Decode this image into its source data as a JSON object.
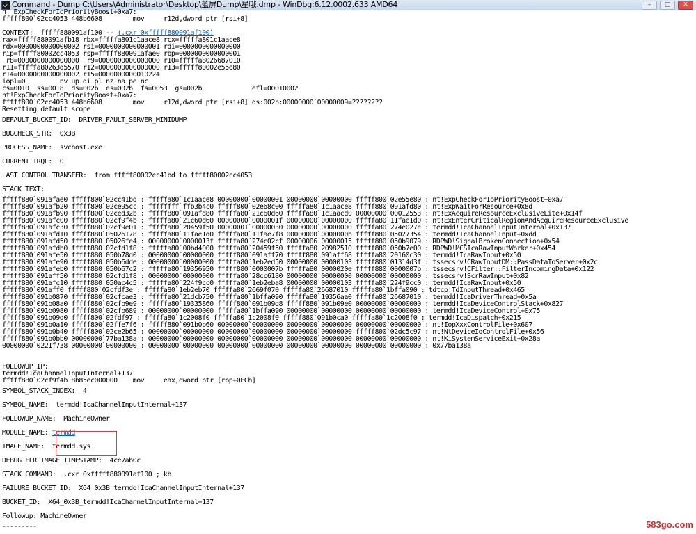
{
  "window": {
    "title": "Command - Dump C:\\Users\\Administrator\\Desktop\\蓝屏Dump\\星哦.dmp - WinDbg:6.12.0002.633 AMD64",
    "buttons": {
      "minimize": "–",
      "maximize": "□",
      "close": "✕"
    }
  },
  "lines": [
    {
      "t": "n! ExpCheckForIoPriorityBoost+0xa7:",
      "k": "line"
    },
    {
      "t": "fffff800`02cc4053 448b6608        mov     r12d,dword ptr [rsi+8]",
      "k": "line"
    },
    {
      "t": "",
      "k": "blank"
    },
    {
      "t": "CONTEXT:  fffff880091af100 -- ",
      "k": "ctx",
      "link": "(.cxr 0xfffff880091af100)"
    },
    {
      "t": "rax=fffff880091afb18 rbx=fffffa801c1aace8 rcx=fffffa801c1aace8",
      "k": "line"
    },
    {
      "t": "rdx=0000000000000002 rsi=0000000000000001 rdi=0000000000000000",
      "k": "line"
    },
    {
      "t": "rip=fffff80002cc4053 rsp=fffff880091afae0 rbp=0000000000000001",
      "k": "line"
    },
    {
      "t": " r8=0000000000000000  r9=0000000000000000 r10=fffffa8026687010",
      "k": "line"
    },
    {
      "t": "r11=fffffa80263d5570 r12=0000000000000000 r13=fffff80002e55e80",
      "k": "line"
    },
    {
      "t": "r14=0000000000000002 r15=0000000000010224",
      "k": "line"
    },
    {
      "t": "iopl=0         nv up di pl nz na pe nc",
      "k": "line"
    },
    {
      "t": "cs=0010  ss=0018  ds=002b  es=002b  fs=0053  gs=002b             efl=00010002",
      "k": "line"
    },
    {
      "t": "nt!ExpCheckForIoPriorityBoost+0xa7:",
      "k": "line"
    },
    {
      "t": "fffff800`02cc4053 448b6608        mov     r12d,dword ptr [rsi+8] ds:002b:00000000`00000009=????????",
      "k": "line"
    },
    {
      "t": "Resetting default scope",
      "k": "line"
    },
    {
      "t": "DEFAULT_BUCKET_ID:  DRIVER_FAULT_SERVER_MINIDUMP",
      "k": "kv"
    },
    {
      "t": "BUGCHECK_STR:  0x3B",
      "k": "kv"
    },
    {
      "t": "PROCESS_NAME:  svchost.exe",
      "k": "kv"
    },
    {
      "t": "CURRENT_IRQL:  0",
      "k": "kv"
    },
    {
      "t": "LAST_CONTROL_TRANSFER:  from fffff80002cc41bd to fffff80002cc4053",
      "k": "kv"
    },
    {
      "t": "STACK_TEXT:",
      "k": "kv"
    },
    {
      "t": "fffff880`091afae0 fffff800`02cc41bd : fffffa80`1c1aace8 00000000`00000001 00000000`00000000 fffff800`02e55e80 : nt!ExpCheckForIoPriorityBoost+0xa7",
      "k": "line"
    },
    {
      "t": "fffff880`091afb20 fffff800`02ce95cc : ffffffff`ffb3b4c0 fffff800`02e68c00 fffffa80`1c1aace8 fffff880`091afd80 : nt!ExpWaitForResource+0x8d",
      "k": "line"
    },
    {
      "t": "fffff880`091afb90 fffff800`02ced32b : fffff880`091afd80 fffffa80`21c60d60 fffffa80`1c1aacd0 00000000`00012553 : nt!ExAcquireResourceExclusiveLite+0x14f",
      "k": "line"
    },
    {
      "t": "fffff880`091afc00 fffff880`02cf9f4b : fffffa80`21c60d60 00000000`0000001f 00000000`00000000 fffffa80`11fae1d0 : nt!ExEnterCriticalRegionAndAcquireResourceExclusive",
      "k": "line"
    },
    {
      "t": "fffff880`091afc30 fffff880`02cf9e01 : fffffa80`20459f50 00000001`00000030 00000000`00000000 fffffa80`274e027e : termdd!IcaChannelInputInternal+0x137",
      "k": "line"
    },
    {
      "t": "fffff880`091afd10 fffff880`05026178 : fffffa80`11fae1d0 fffffa80`11fae7f8 00000000`0000000b fffff880`05027354 : termdd!IcaChannelInput+0xdd",
      "k": "line"
    },
    {
      "t": "fffff880`091afd50 fffff880`05026fe4 : 00000000`0000013f fffffa80`274c02cf 00000006`00000015 fffff880`050b9079 : RDPWD!SignalBrokenConnection+0x54",
      "k": "line"
    },
    {
      "t": "fffff880`091afdb0 fffff880`02cfd1f8 : fffffa80`00bd4000 fffffa80`20459f50 fffffa80`20982510 fffff880`050b7e00 : RDPWD!MCSIcaRawInputWorker+0x454",
      "k": "line"
    },
    {
      "t": "fffff880`091afe50 fffff880`050b78d0 : 00000000`00000000 fffff880`091aff70 fffff880`091aff68 fffffa80`20160c30 : termdd!IcaRawInput+0x50",
      "k": "line"
    },
    {
      "t": "fffff880`091afe90 fffff880`050b6dde : 00000000`00000000 fffffa80`1eb2ed50 00000000`00000103 fffff880`01314d3f : tssecsrv!CRawInputDM::PassDataToServer+0x2c",
      "k": "line"
    },
    {
      "t": "fffff880`091afeb0 fffff880`050b67c2 : fffffa80`19356950 fffff880`0000007b fffffa80`0000020e fffff880`0000007b : tssecsrv!CFilter::FilterIncomingData+0x122",
      "k": "line"
    },
    {
      "t": "fffff880`091aff50 fffff880`02cfd1f8 : 00000000`00000000 fffffa80`28cc6180 00000000`00000000 00000000`00000000 : tssecsrv!ScrRawInput+0x82",
      "k": "line"
    },
    {
      "t": "fffff880`091afc10 fffff880`050ac4c5 : fffffa80`224f9cc0 fffffa80`1eb2eba8 00000000`00000103 fffffa80`224f9cc0 : termdd!IcaRawInput+0x50",
      "k": "line"
    },
    {
      "t": "fffff880`091aff0 fffff880`02cfdf3e : fffffa80`1eb2eb70 fffffa80`2669f070 fffffa80`26687010 fffffa80`1bffa090 : tdtcp!TdInputThread+0x465",
      "k": "line"
    },
    {
      "t": "fffff880`091b0870 fffff880`02cfcae3 : fffffa80`21dcb750 fffffa80`1bffa090 fffffa80`19356aa0 fffffa80`26687010 : termdd!IcaDriverThread+0x5a",
      "k": "line"
    },
    {
      "t": "fffff880`091b08a0 fffff880`02cfb9e9 : fffffa80`19335860 fffff880`091b09d8 fffff880`091b09e0 00000000`00000000 : termdd!IcaDeviceControlStack+0x827",
      "k": "line"
    },
    {
      "t": "fffff880`091b0980 fffff880`02cfb689 : 00000000`00000000 fffffa80`1bffa090 00000000`00000000 00000000`00000000 : termdd!IcaDeviceControl+0x75",
      "k": "line"
    },
    {
      "t": "fffff880`091b09d0 fffff800`02fdf97 : fffffa80`1c2008f0 fffffa80`1c2008f0 fffff880`091b0ca0 fffffa80`1c2008f0 : termdd!IcaDispatch+0x215",
      "k": "line"
    },
    {
      "t": "fffff880`091b0a10 fffff800`02ffe7f6 : fffff880`091b0b60 00000000`00000000 00000000`00000000 00000000`00000000 : nt!IopXxxControlFile+0x607",
      "k": "line"
    },
    {
      "t": "fffff880`091b0b40 fffff800`02ce2b65 : 00000000`00000000 00000000`00000000 00000000`00000000 fffff800`02dc5c97 : nt!NtDeviceIoControlFile+0x56",
      "k": "line"
    },
    {
      "t": "fffff880`091b0bb0 00000000`77ba138a : 00000000`00000000 00000000`00000000 00000000`00000000 00000000`00000000 : nt!KiSystemServiceExit+0x28a",
      "k": "line"
    },
    {
      "t": "00000000`0221f738 00000000`00000000 : 00000000`00000000 00000000`00000000 00000000`00000000 00000000`00000000 : 0x77ba138a",
      "k": "line"
    },
    {
      "t": "",
      "k": "blank"
    },
    {
      "t": "",
      "k": "blank"
    },
    {
      "t": "FOLLOWUP_IP:",
      "k": "line"
    },
    {
      "t": "termdd!IcaChannelInputInternal+137",
      "k": "line"
    },
    {
      "t": "fffff880`02cf9f4b 8b85ec000000    mov     eax,dword ptr [rbp+0ECh]",
      "k": "line"
    },
    {
      "t": "SYMBOL_STACK_INDEX:  4",
      "k": "kv"
    },
    {
      "t": "SYMBOL_NAME:  termdd!IcaChannelInputInternal+137",
      "k": "kv"
    },
    {
      "t": "FOLLOWUP_NAME:  MachineOwner",
      "k": "kv"
    },
    {
      "t": "MODULE_NAME: ",
      "k": "module",
      "link": "termdd"
    },
    {
      "t": "IMAGE_NAME:  termdd.sys",
      "k": "kv"
    },
    {
      "t": "DEBUG_FLR_IMAGE_TIMESTAMP:  4ce7ab0c",
      "k": "kv"
    },
    {
      "t": "STACK_COMMAND:  .cxr 0xfffff880091af100 ; kb",
      "k": "kv"
    },
    {
      "t": "FAILURE_BUCKET_ID:  X64_0x3B_termdd!IcaChannelInputInternal+137",
      "k": "kv"
    },
    {
      "t": "BUCKET_ID:  X64_0x3B_termdd!IcaChannelInputInternal+137",
      "k": "kv"
    },
    {
      "t": "Followup: MachineOwner",
      "k": "kv"
    },
    {
      "t": "---------",
      "k": "line"
    }
  ],
  "watermark": "583go.com"
}
